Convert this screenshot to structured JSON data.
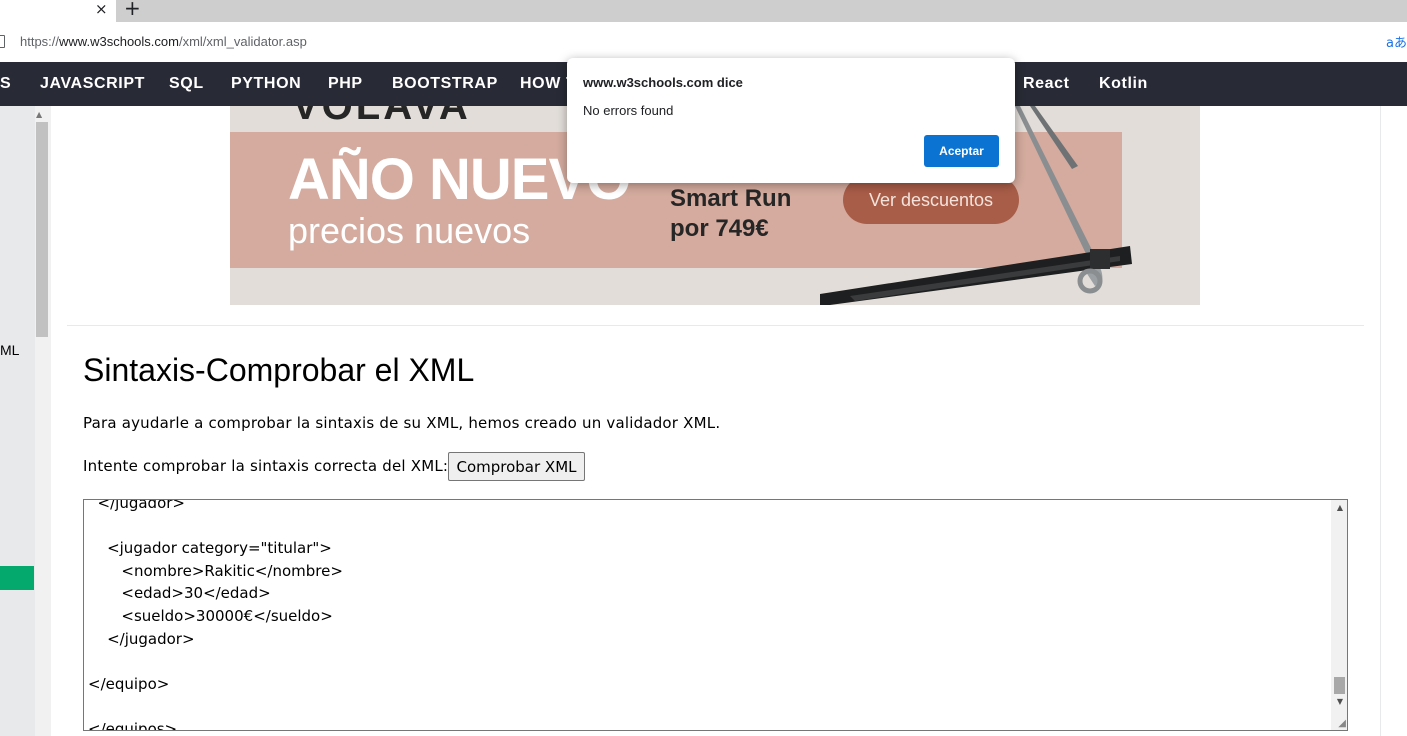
{
  "browser": {
    "tab_close": "×",
    "new_tab": "+",
    "url_prefix": "https://",
    "url_host": "www.w3schools.com",
    "url_path": "/xml/xml_validator.asp",
    "translate": "aあ"
  },
  "nav": {
    "items": [
      "S",
      "JAVASCRIPT",
      "SQL",
      "PYTHON",
      "PHP",
      "BOOTSTRAP",
      "HOW T",
      "React",
      "Kotlin"
    ]
  },
  "sidebar": {
    "partial_label": "ML"
  },
  "ad": {
    "brand": "VOLAVA",
    "headline": "AÑO NUEVO",
    "subline": "precios nuevos",
    "product_line1": "Smart Run",
    "product_line2": "por 749€",
    "cta": "Ver descuentos"
  },
  "content": {
    "title": "Sintaxis-Comprobar el XML",
    "para1": "Para ayudarle a comprobar la sintaxis de su XML, hemos creado un validador XML.",
    "para2": "Intente comprobar la sintaxis correcta del XML:",
    "check_button": "Comprobar XML",
    "code": "  </jugador>\n\n    <jugador category=\"titular\">\n       <nombre>Rakitic</nombre>\n       <edad>30</edad>\n       <sueldo>30000€</sueldo>\n    </jugador>\n\n</equipo>\n\n</equipos>"
  },
  "dialog": {
    "title": "www.w3schools.com dice",
    "message": "No errors found",
    "accept": "Aceptar"
  },
  "colors": {
    "navbar": "#282a35",
    "accent_green": "#04aa6d",
    "dialog_button": "#0b73d2"
  }
}
